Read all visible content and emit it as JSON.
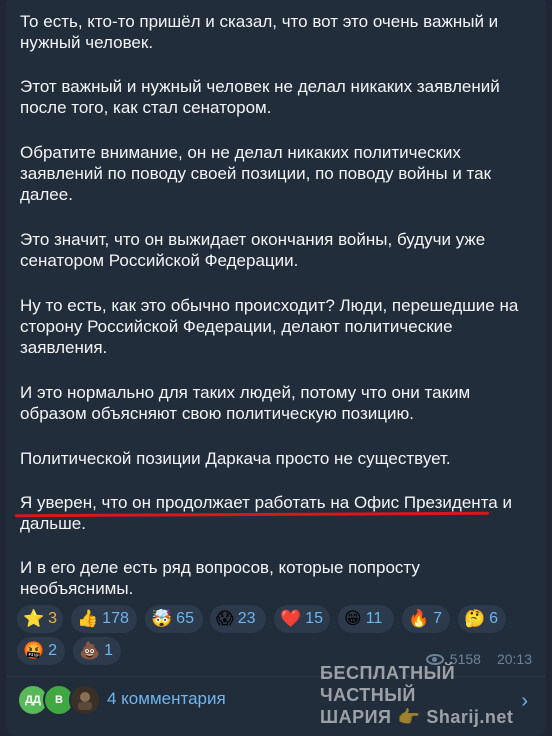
{
  "paragraphs": [
    "То есть, кто-то пришёл и сказал, что вот это очень важный и\nнужный человек.",
    "Этот важный и нужный человек не делал никаких заявлений\nпосле того, как стал сенатором.",
    "Обратите внимание, он не делал никаких политических\nзаявлений по поводу своей позиции, по поводу войны и так\nдалее.",
    "Это значит, что он выжидает окончания войны, будучи уже\nсенатором Российской Федерации.",
    "Ну то есть, как это обычно происходит? Люди, перешедшие на\nсторону Российской Федерации, делают политические\nзаявления.",
    "И это нормально для таких людей, потому что они таким\nобразом объясняют свою политическую позицию.",
    "Политической позиции Даркача просто не существует.",
    "Я уверен, что он продолжает работать на Офис Президента и\nдальше.",
    "И в его деле есть ряд вопросов, которые попросту\nнеобъяснимы."
  ],
  "reactions": [
    {
      "emoji": "⭐",
      "icon": "star-icon",
      "count": "3",
      "color": "#e3b341"
    },
    {
      "emoji": "👍",
      "icon": "thumbs-up-icon",
      "count": "178"
    },
    {
      "emoji": "🤯",
      "icon": "exploding-head-icon",
      "count": "65"
    },
    {
      "emoji": "😱",
      "icon": "screaming-face-icon",
      "count": "23"
    },
    {
      "emoji": "❤️",
      "icon": "heart-icon",
      "count": "15"
    },
    {
      "emoji": "😁",
      "icon": "grinning-face-icon",
      "count": "11"
    },
    {
      "emoji": "🔥",
      "icon": "fire-icon",
      "count": "7"
    },
    {
      "emoji": "🤔",
      "icon": "thinking-face-icon",
      "count": "6"
    },
    {
      "emoji": "🤬",
      "icon": "angry-face-icon",
      "count": "2"
    },
    {
      "emoji": "💩",
      "icon": "poop-icon",
      "count": "1"
    }
  ],
  "meta": {
    "views": "5158",
    "time": "20:13"
  },
  "comments": {
    "label": "4 комментария",
    "avatars": [
      {
        "initials": "ДД",
        "color": "#59b85a"
      },
      {
        "initials": "В",
        "color": "#3fa843"
      },
      {
        "initials": "",
        "color": "#3a3028"
      }
    ]
  },
  "watermark": {
    "line1": "БЕСПЛАТНЫЙ ЧАСТНЫЙ",
    "line2a": "ШАРИЯ",
    "line2b": "Sharij.net"
  },
  "colors": {
    "background": "#1e2733",
    "bubble": "#212d3b",
    "accent": "#6fb5ee",
    "underline": "#d8161b"
  }
}
